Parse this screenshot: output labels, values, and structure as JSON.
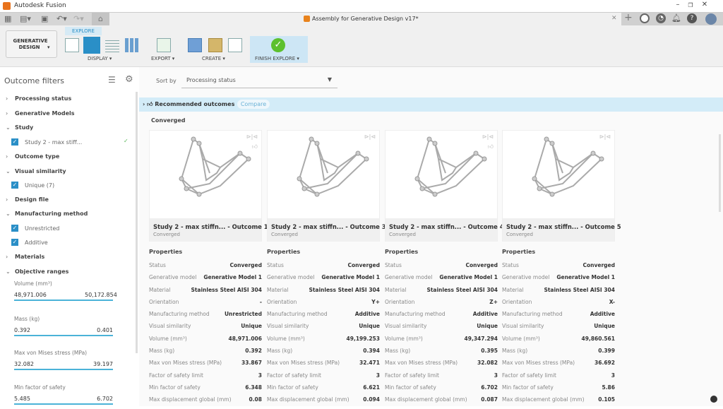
{
  "app": {
    "title": "Autodesk Fusion",
    "document_tab": "Assembly for Generative Design v17*"
  },
  "window_controls": {
    "minimize": "–",
    "restore": "❐",
    "close": "✕"
  },
  "ribbon": {
    "workspace": "GENERATIVE DESIGN",
    "tab": "EXPLORE",
    "groups": {
      "display": "DISPLAY ▾",
      "export": "EXPORT ▾",
      "create": "CREATE ▾",
      "finish": "FINISH EXPLORE ▾"
    }
  },
  "sidebar": {
    "title": "Outcome filters",
    "filters": [
      {
        "label": "Processing status",
        "expanded": false
      },
      {
        "label": "Generative Models",
        "expanded": false
      },
      {
        "label": "Study",
        "expanded": true
      },
      {
        "label": "Outcome type",
        "expanded": false
      },
      {
        "label": "Visual similarity",
        "expanded": true
      },
      {
        "label": "Design file",
        "expanded": false
      },
      {
        "label": "Manufacturing method",
        "expanded": true
      },
      {
        "label": "Materials",
        "expanded": false
      },
      {
        "label": "Objective ranges",
        "expanded": true
      }
    ],
    "checks": {
      "study": "Study 2 - max stiff...",
      "unique": "Unique (7)",
      "unrestricted": "Unrestricted",
      "additive": "Additive"
    },
    "ranges": [
      {
        "label": "Volume (mm³)",
        "min": "48,971.006",
        "max": "50,172.854"
      },
      {
        "label": "Mass (kg)",
        "min": "0.392",
        "max": "0.401"
      },
      {
        "label": "Max von Mises stress (MPa)",
        "min": "32.082",
        "max": "39.197"
      },
      {
        "label": "Min factor of safety",
        "min": "5.485",
        "max": "6.702"
      }
    ]
  },
  "main": {
    "sort_label": "Sort by",
    "sort_value": "Processing status",
    "recommended": "Recommended outcomes",
    "compare": "Compare",
    "group": "Converged",
    "properties_title": "Properties",
    "property_labels": [
      "Status",
      "Generative model",
      "Material",
      "Orientation",
      "Manufacturing method",
      "Visual similarity",
      "Volume (mm³)",
      "Mass (kg)",
      "Max von Mises stress (MPa)",
      "Factor of safety limit",
      "Min factor of safety",
      "Max displacement global (mm)"
    ],
    "outcomes": [
      {
        "title": "Study 2 - max stiffn... - Outcome 1",
        "status": "Converged",
        "values": [
          "Converged",
          "Generative Model 1",
          "Stainless Steel AISI 304",
          "-",
          "Unrestricted",
          "Unique",
          "48,971.006",
          "0.392",
          "33.867",
          "3",
          "6.348",
          "0.08"
        ]
      },
      {
        "title": "Study 2 - max stiffn... - Outcome 3",
        "status": "Converged",
        "values": [
          "Converged",
          "Generative Model 1",
          "Stainless Steel AISI 304",
          "Y+",
          "Additive",
          "Unique",
          "49,199.253",
          "0.394",
          "32.471",
          "3",
          "6.621",
          "0.094"
        ]
      },
      {
        "title": "Study 2 - max stiffn... - Outcome 4",
        "status": "Converged",
        "values": [
          "Converged",
          "Generative Model 1",
          "Stainless Steel AISI 304",
          "Z+",
          "Additive",
          "Unique",
          "49,347.294",
          "0.395",
          "32.082",
          "3",
          "6.702",
          "0.087"
        ]
      },
      {
        "title": "Study 2 - max stiffn... - Outcome 5",
        "status": "Converged",
        "values": [
          "Converged",
          "Generative Model 1",
          "Stainless Steel AISI 304",
          "X-",
          "Additive",
          "Unique",
          "49,860.561",
          "0.399",
          "36.692",
          "3",
          "5.86",
          "0.105"
        ]
      }
    ]
  }
}
